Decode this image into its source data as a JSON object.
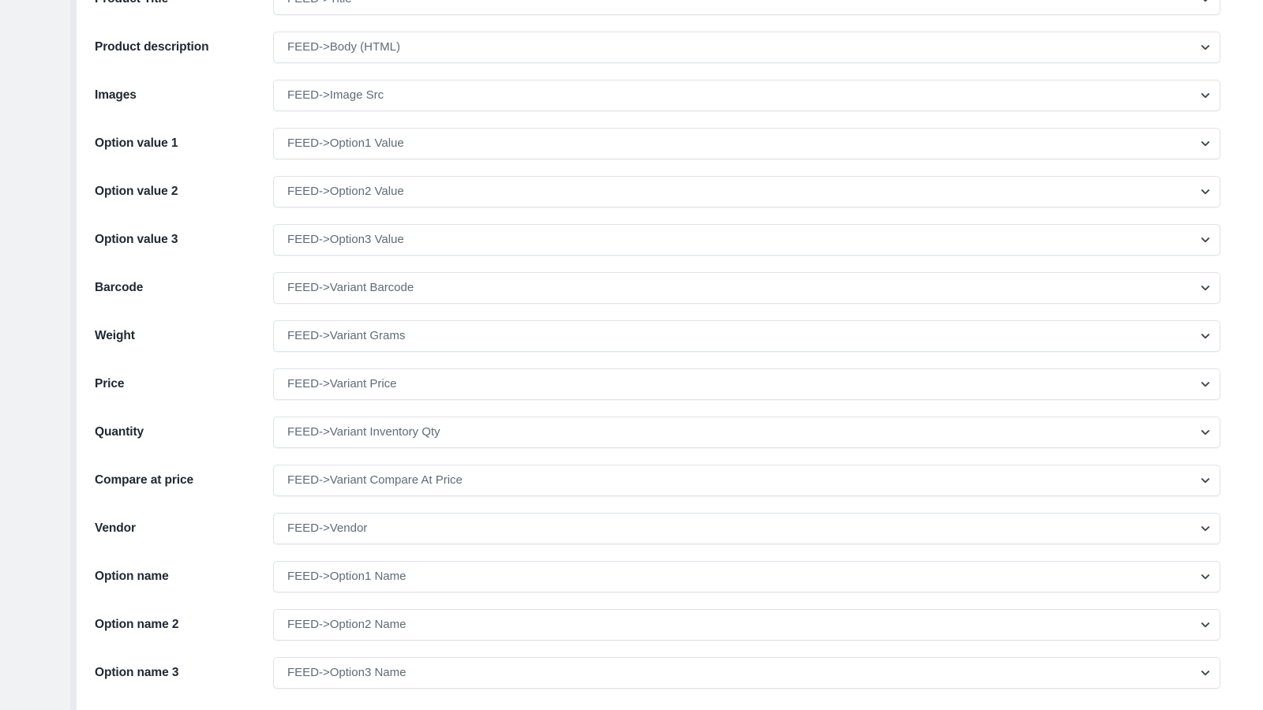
{
  "layout": {
    "gutter_color": "#f1f2f4",
    "divider_color": "#e8eaed",
    "content_background": "#ffffff",
    "label_color": "#1f2733",
    "select_text_color": "#5f6b7a",
    "select_border_color": "#dfe3e8",
    "chevron_color": "#3d444d"
  },
  "form": {
    "rows": [
      {
        "label": "Product Title",
        "value": "FEED->Title",
        "icon": "chevron-down-icon"
      },
      {
        "label": "Product description",
        "value": "FEED->Body (HTML)",
        "icon": "chevron-down-icon"
      },
      {
        "label": "Images",
        "value": "FEED->Image Src",
        "icon": "chevron-down-icon"
      },
      {
        "label": "Option value 1",
        "value": "FEED->Option1 Value",
        "icon": "chevron-down-icon"
      },
      {
        "label": "Option value 2",
        "value": "FEED->Option2 Value",
        "icon": "chevron-down-icon"
      },
      {
        "label": "Option value 3",
        "value": "FEED->Option3 Value",
        "icon": "chevron-down-icon"
      },
      {
        "label": "Barcode",
        "value": "FEED->Variant Barcode",
        "icon": "chevron-down-icon"
      },
      {
        "label": "Weight",
        "value": "FEED->Variant Grams",
        "icon": "chevron-down-icon"
      },
      {
        "label": "Price",
        "value": "FEED->Variant Price",
        "icon": "chevron-down-icon"
      },
      {
        "label": "Quantity",
        "value": "FEED->Variant Inventory Qty",
        "icon": "chevron-down-icon"
      },
      {
        "label": "Compare at price",
        "value": "FEED->Variant Compare At Price",
        "icon": "chevron-down-icon"
      },
      {
        "label": "Vendor",
        "value": "FEED->Vendor",
        "icon": "chevron-down-icon"
      },
      {
        "label": "Option name",
        "value": "FEED->Option1 Name",
        "icon": "chevron-down-icon"
      },
      {
        "label": "Option name 2",
        "value": "FEED->Option2 Name",
        "icon": "chevron-down-icon"
      },
      {
        "label": "Option name 3",
        "value": "FEED->Option3 Name",
        "icon": "chevron-down-icon"
      }
    ]
  }
}
